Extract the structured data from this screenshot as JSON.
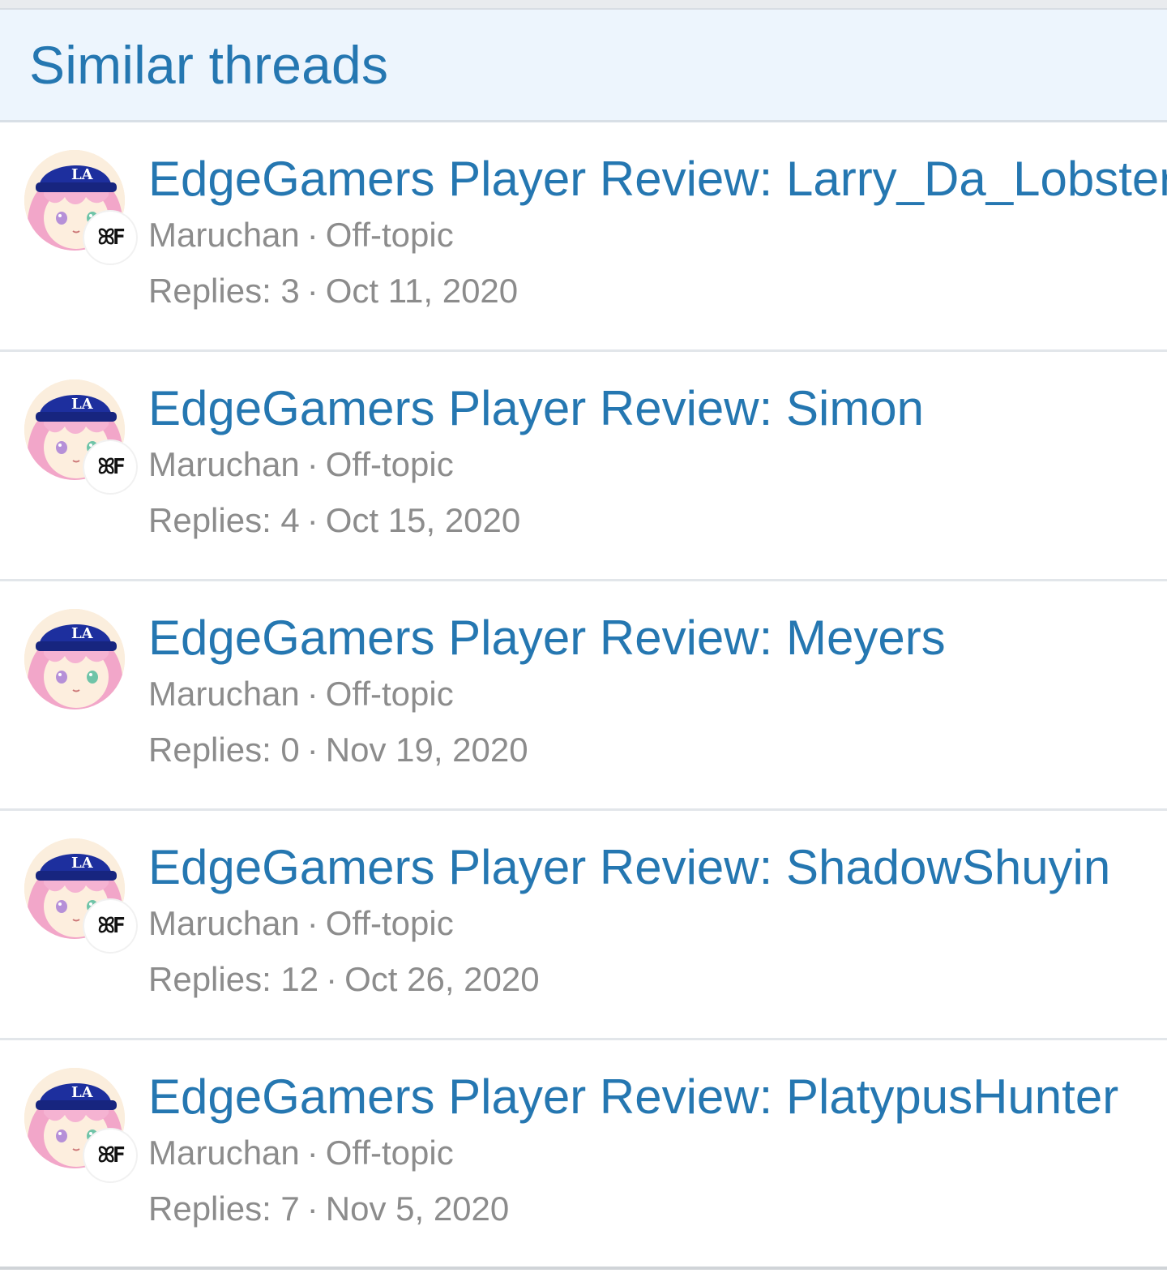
{
  "block": {
    "title": "Similar threads"
  },
  "threads": [
    {
      "title": "EdgeGamers Player Review: Larry_Da_Lobster",
      "author": "Maruchan",
      "forum": "Off-topic",
      "replies_label": "Replies: 3",
      "date": "Oct 11, 2020",
      "has_badge": true
    },
    {
      "title": "EdgeGamers Player Review: Simon",
      "author": "Maruchan",
      "forum": "Off-topic",
      "replies_label": "Replies: 4",
      "date": "Oct 15, 2020",
      "has_badge": true
    },
    {
      "title": "EdgeGamers Player Review: Meyers",
      "author": "Maruchan",
      "forum": "Off-topic",
      "replies_label": "Replies: 0",
      "date": "Nov 19, 2020",
      "has_badge": false
    },
    {
      "title": "EdgeGamers Player Review: ShadowShuyin",
      "author": "Maruchan",
      "forum": "Off-topic",
      "replies_label": "Replies: 12",
      "date": "Oct 26, 2020",
      "has_badge": true
    },
    {
      "title": "EdgeGamers Player Review: PlatypusHunter",
      "author": "Maruchan",
      "forum": "Off-topic",
      "replies_label": "Replies: 7",
      "date": "Nov 5, 2020",
      "has_badge": true
    }
  ],
  "separator": "·",
  "avatar": {
    "icon": "user-avatar-icon",
    "cap_text": "LA",
    "badge_text": "ꕤF"
  },
  "colors": {
    "link": "#2577b1",
    "muted": "#8c8c8c",
    "header_bg": "#edf5fd",
    "cap_blue": "#1d2f9e",
    "hair_pink": "#f2a6c9"
  }
}
